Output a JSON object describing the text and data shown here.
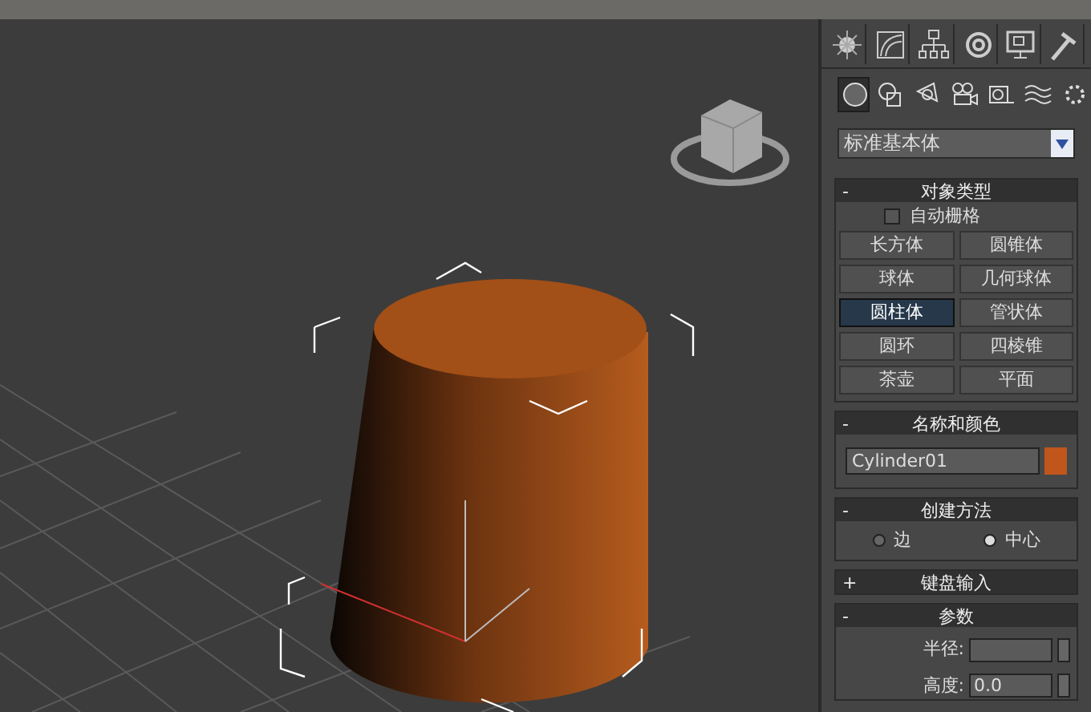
{
  "object_categories": [
    {
      "selected": true
    },
    {
      "selected": false
    },
    {
      "selected": false
    },
    {
      "selected": false
    },
    {
      "selected": false
    },
    {
      "selected": false
    },
    {
      "selected": false
    }
  ],
  "dropdown": {
    "value": "标准基本体"
  },
  "object_type": {
    "toggle": "-",
    "title": "对象类型",
    "auto_grid": {
      "label": "自动栅格",
      "checked": false
    },
    "buttons": [
      {
        "label": "长方体",
        "selected": false
      },
      {
        "label": "圆锥体",
        "selected": false
      },
      {
        "label": "球体",
        "selected": false
      },
      {
        "label": "几何球体",
        "selected": false
      },
      {
        "label": "圆柱体",
        "selected": true
      },
      {
        "label": "管状体",
        "selected": false
      },
      {
        "label": "圆环",
        "selected": false
      },
      {
        "label": "四棱锥",
        "selected": false
      },
      {
        "label": "茶壶",
        "selected": false
      },
      {
        "label": "平面",
        "selected": false
      }
    ]
  },
  "name_and_color": {
    "toggle": "-",
    "title": "名称和颜色",
    "name": "Cylinder01",
    "color": "#c0561b"
  },
  "creation_method": {
    "toggle": "-",
    "title": "创建方法",
    "options": [
      {
        "label": "边",
        "selected": false
      },
      {
        "label": "中心",
        "selected": true
      }
    ]
  },
  "keyboard_entry": {
    "toggle": "+",
    "title": "键盘输入"
  },
  "parameters": {
    "toggle": "-",
    "title": "参数",
    "fields": [
      {
        "label": "半径:"
      },
      {
        "label": "高度:",
        "value": "0.0"
      }
    ]
  }
}
